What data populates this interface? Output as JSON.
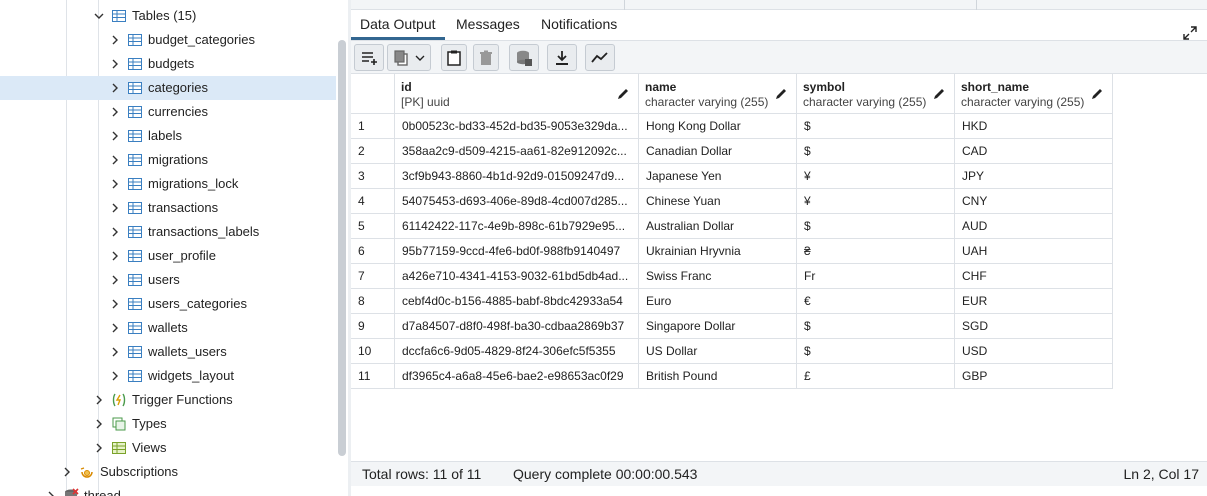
{
  "tree": {
    "tables_group": {
      "label": "Tables (15)"
    },
    "tables": [
      "budget_categories",
      "budgets",
      "categories",
      "currencies",
      "labels",
      "migrations",
      "migrations_lock",
      "transactions",
      "transactions_labels",
      "user_profile",
      "users",
      "users_categories",
      "wallets",
      "wallets_users",
      "widgets_layout"
    ],
    "selected_table": "categories",
    "trigger_functions": {
      "label": "Trigger Functions"
    },
    "types": {
      "label": "Types"
    },
    "views": {
      "label": "Views"
    },
    "subscriptions": {
      "label": "Subscriptions"
    },
    "thread": {
      "label": "thread"
    }
  },
  "tabs": [
    {
      "label": "Data Output",
      "active": true
    },
    {
      "label": "Messages",
      "active": false
    },
    {
      "label": "Notifications",
      "active": false
    }
  ],
  "toolbar": {
    "buttons": [
      "add-row-icon",
      "copy-icon",
      "copy-options-icon",
      "paste-icon",
      "delete-icon",
      "save-data-icon",
      "download-icon",
      "graph-icon"
    ]
  },
  "grid": {
    "columns": [
      {
        "name": "id",
        "type": "[PK] uuid"
      },
      {
        "name": "name",
        "type": "character varying (255)"
      },
      {
        "name": "symbol",
        "type": "character varying (255)"
      },
      {
        "name": "short_name",
        "type": "character varying (255)"
      }
    ],
    "rows": [
      [
        "1",
        "0b00523c-bd33-452d-bd35-9053e329da...",
        "Hong Kong Dollar",
        "$",
        "HKD"
      ],
      [
        "2",
        "358aa2c9-d509-4215-aa61-82e912092c...",
        "Canadian Dollar",
        "$",
        "CAD"
      ],
      [
        "3",
        "3cf9b943-8860-4b1d-92d9-01509247d9...",
        "Japanese Yen",
        "¥",
        "JPY"
      ],
      [
        "4",
        "54075453-d693-406e-89d8-4cd007d285...",
        "Chinese Yuan",
        "¥",
        "CNY"
      ],
      [
        "5",
        "61142422-117c-4e9b-898c-61b7929e95...",
        "Australian Dollar",
        "$",
        "AUD"
      ],
      [
        "6",
        "95b77159-9ccd-4fe6-bd0f-988fb9140497",
        "Ukrainian Hryvnia",
        "₴",
        "UAH"
      ],
      [
        "7",
        "a426e710-4341-4153-9032-61bd5db4ad...",
        "Swiss Franc",
        "Fr",
        "CHF"
      ],
      [
        "8",
        "cebf4d0c-b156-4885-babf-8bdc42933a54",
        "Euro",
        "€",
        "EUR"
      ],
      [
        "9",
        "d7a84507-d8f0-498f-ba30-cdbaa2869b37",
        "Singapore Dollar",
        "$",
        "SGD"
      ],
      [
        "10",
        "dccfa6c6-9d05-4829-8f24-306efc5f5355",
        "US Dollar",
        "$",
        "USD"
      ],
      [
        "11",
        "df3965c4-a6a8-45e6-bae2-e98653ac0f29",
        "British Pound",
        "£",
        "GBP"
      ]
    ]
  },
  "status": {
    "total_rows": "Total rows: 11 of 11",
    "query": "Query complete 00:00:00.543",
    "position": "Ln 2, Col 17"
  },
  "colors": {
    "accent": "#326690",
    "selected_row": "#dbe9f7",
    "table_icon": "#3a7fc1"
  }
}
